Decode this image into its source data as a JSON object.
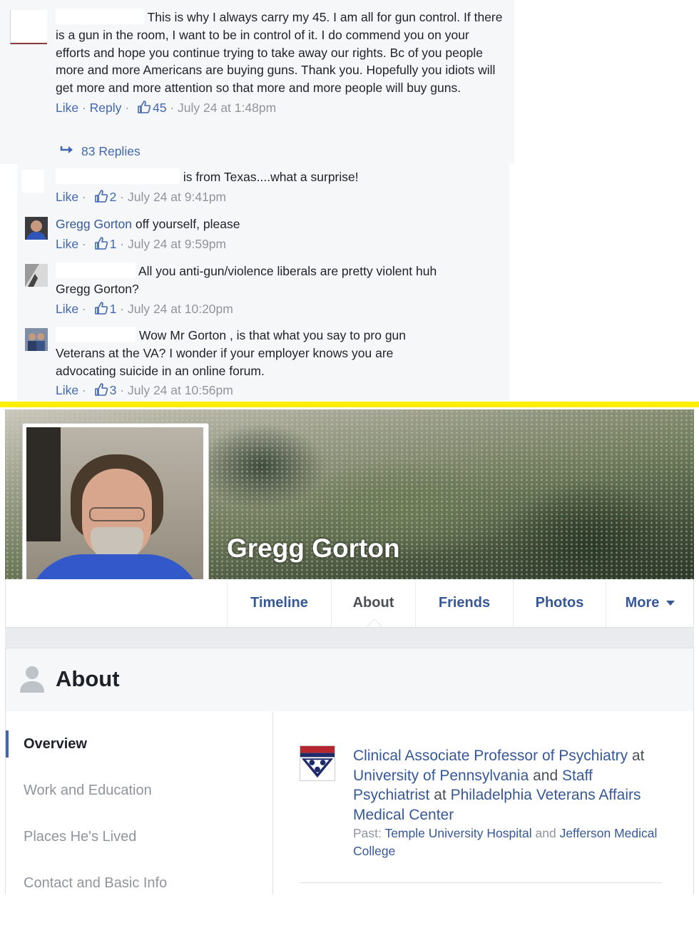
{
  "comments": {
    "main": {
      "text": "This is why I always carry my 45. I am all for gun control. If there is a gun in the room, I want to be in control of it. I do commend you on your efforts and hope you continue trying to take away our rights. Bc of you people more and more Americans are buying guns. Thank you. Hopefully you idiots will get more and more attention so that more and more people will buy guns.",
      "like_label": "Like",
      "reply_label": "Reply",
      "likes": "45",
      "time": "July 24 at 1:48pm",
      "replies_label": "83 Replies"
    },
    "replies": [
      {
        "author": "",
        "text": "is from Texas....what a surprise!",
        "likes": "2",
        "time": "July 24 at 9:41pm"
      },
      {
        "author": "Gregg Gorton",
        "text": "off yourself, please",
        "likes": "1",
        "time": "July 24 at 9:59pm"
      },
      {
        "author": "",
        "text": "All you anti-gun/violence liberals are pretty violent huh Gregg Gorton?",
        "likes": "1",
        "time": "July 24 at 10:20pm"
      },
      {
        "author": "",
        "text": "Wow Mr Gorton , is that what you say to pro gun Veterans at the VA? I wonder if your employer knows you are advocating suicide in an online forum.",
        "likes": "3",
        "time": "July 24 at 10:56pm"
      }
    ],
    "like_label": "Like"
  },
  "profile": {
    "name": "Gregg Gorton",
    "tabs": [
      "Timeline",
      "About",
      "Friends",
      "Photos",
      "More"
    ],
    "active_tab": "About"
  },
  "about": {
    "title": "About",
    "sidebar": [
      "Overview",
      "Work and Education",
      "Places He's Lived",
      "Contact and Basic Info"
    ],
    "work": {
      "role1": "Clinical Associate Professor of Psychiatry",
      "at": "at",
      "org1": "University of Pennsylvania",
      "and": "and",
      "role2": "Staff Psychiatrist",
      "org2": "Philadelphia Veterans Affairs Medical Center",
      "past_label": "Past:",
      "past1": "Temple University Hospital",
      "past_and": "and",
      "past2": "Jefferson Medical College"
    }
  },
  "colors": {
    "link": "#365899",
    "meta": "#90949c",
    "divider": "#ffee00",
    "like_blue": "#4267b2"
  }
}
